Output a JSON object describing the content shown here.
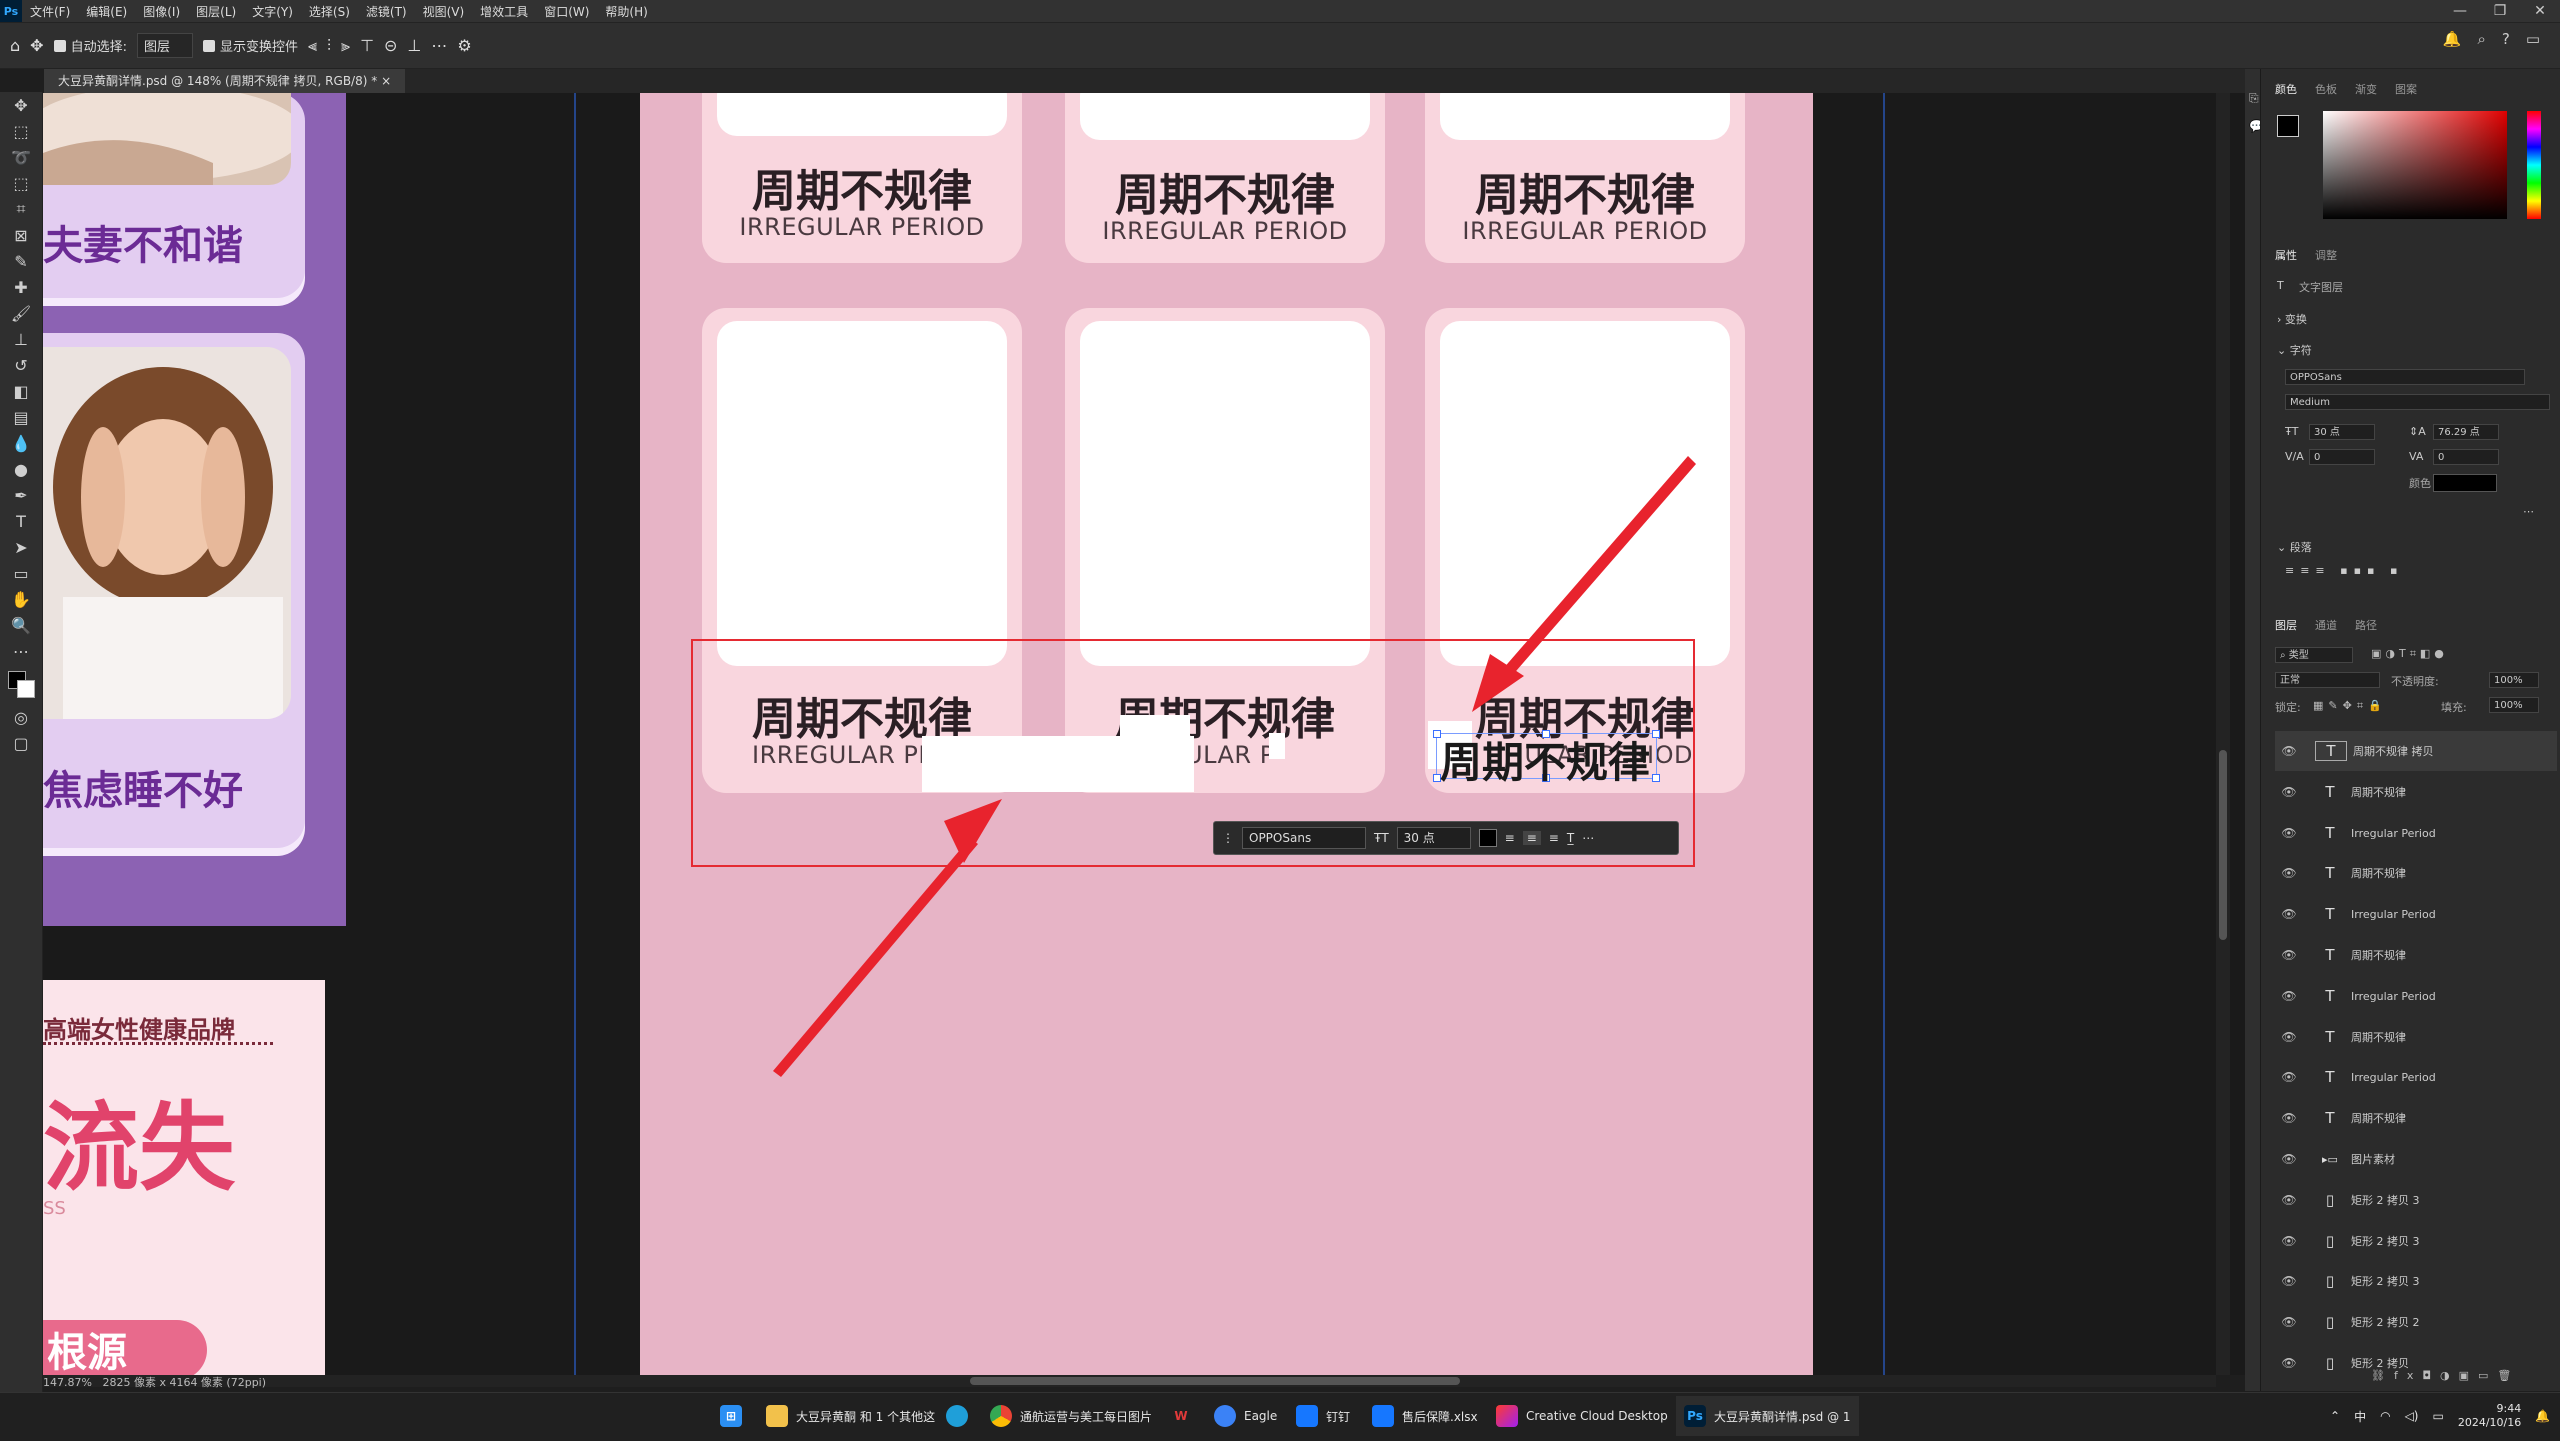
{
  "menubar": {
    "app_icon": "Ps",
    "items": [
      "文件(F)",
      "编辑(E)",
      "图像(I)",
      "图层(L)",
      "文字(Y)",
      "选择(S)",
      "滤镜(T)",
      "视图(V)",
      "增效工具",
      "窗口(W)",
      "帮助(H)"
    ]
  },
  "options": {
    "auto_select": "自动选择:",
    "layer_dd": "图层",
    "transform_controls": "显示变换控件"
  },
  "tab": {
    "title": "大豆异黄酮详情.psd @ 148% (周期不规律 拷贝, RGB/8) *"
  },
  "canvas": {
    "left_labels": [
      "夫妻不和谐",
      "焦虑睡不好"
    ],
    "left_doc2": {
      "line1": "高端女性健康品牌",
      "line2": "流失",
      "line3": "SS",
      "line4": "根源"
    },
    "cards": [
      {
        "cn": "周期不规律",
        "en": "IRREGULAR PERIOD"
      },
      {
        "cn": "周期不规律",
        "en": "IRREGULAR PERIOD"
      },
      {
        "cn": "周期不规律",
        "en": "IRREGULAR PERIOD"
      },
      {
        "cn": "周期不规律",
        "en": "IRREGULAR PL"
      },
      {
        "cn": "周期不规律",
        "en": "ULAR P"
      },
      {
        "cn": "周期不规律",
        "en": "ULAR PERIOD"
      }
    ],
    "editing_text": "周期不规律",
    "context_bar": {
      "font": "OPPOSans",
      "size": "30 点"
    }
  },
  "status": {
    "zoom": "147.87%",
    "doc": "2825 像素 x 4164 像素 (72ppi)"
  },
  "panels": {
    "color_tabs": [
      "颜色",
      "色板",
      "渐变",
      "图案"
    ],
    "props_tabs": [
      "属性",
      "调整"
    ],
    "layer_type": "文字图层",
    "transform": "变换",
    "char": "字符",
    "font": "OPPOSans",
    "weight": "Medium",
    "size": "30 点",
    "leading": "76.29 点",
    "kerning": "0",
    "tracking": "0",
    "color_label": "颜色",
    "paragraph": "段落",
    "layers_tabs": [
      "图层",
      "通道",
      "路径"
    ],
    "filter": "类型",
    "blend": "正常",
    "opacity_label": "不透明度:",
    "opacity": "100%",
    "lock_label": "锁定:",
    "fill_label": "填充:",
    "fill": "100%",
    "layers": [
      {
        "name": "周期不规律 拷贝",
        "type": "text",
        "selected": true
      },
      {
        "name": "周期不规律",
        "type": "text"
      },
      {
        "name": "Irregular Period",
        "type": "text"
      },
      {
        "name": "周期不规律",
        "type": "text"
      },
      {
        "name": "Irregular Period",
        "type": "text"
      },
      {
        "name": "周期不规律",
        "type": "text"
      },
      {
        "name": "Irregular Period",
        "type": "text"
      },
      {
        "name": "周期不规律",
        "type": "text"
      },
      {
        "name": "Irregular Period",
        "type": "text"
      },
      {
        "name": "周期不规律",
        "type": "text"
      },
      {
        "name": "图片素材",
        "type": "group"
      },
      {
        "name": "矩形 2 拷贝 3",
        "type": "shape"
      },
      {
        "name": "矩形 2 拷贝 3",
        "type": "shape"
      },
      {
        "name": "矩形 2 拷贝 3",
        "type": "shape"
      },
      {
        "name": "矩形 2 拷贝 2",
        "type": "shape"
      },
      {
        "name": "矩形 2 拷贝",
        "type": "shape"
      }
    ]
  },
  "taskbar": {
    "items": [
      "大豆异黄酮 和 1 个其他这",
      "通航运营与美工每日图片",
      "Eagle",
      "钉钉",
      "售后保障.xlsx",
      "Creative Cloud Desktop",
      "大豆异黄酮详情.psd @ 1"
    ],
    "time": "9:44",
    "date": "2024/10/16",
    "ime": "中"
  }
}
